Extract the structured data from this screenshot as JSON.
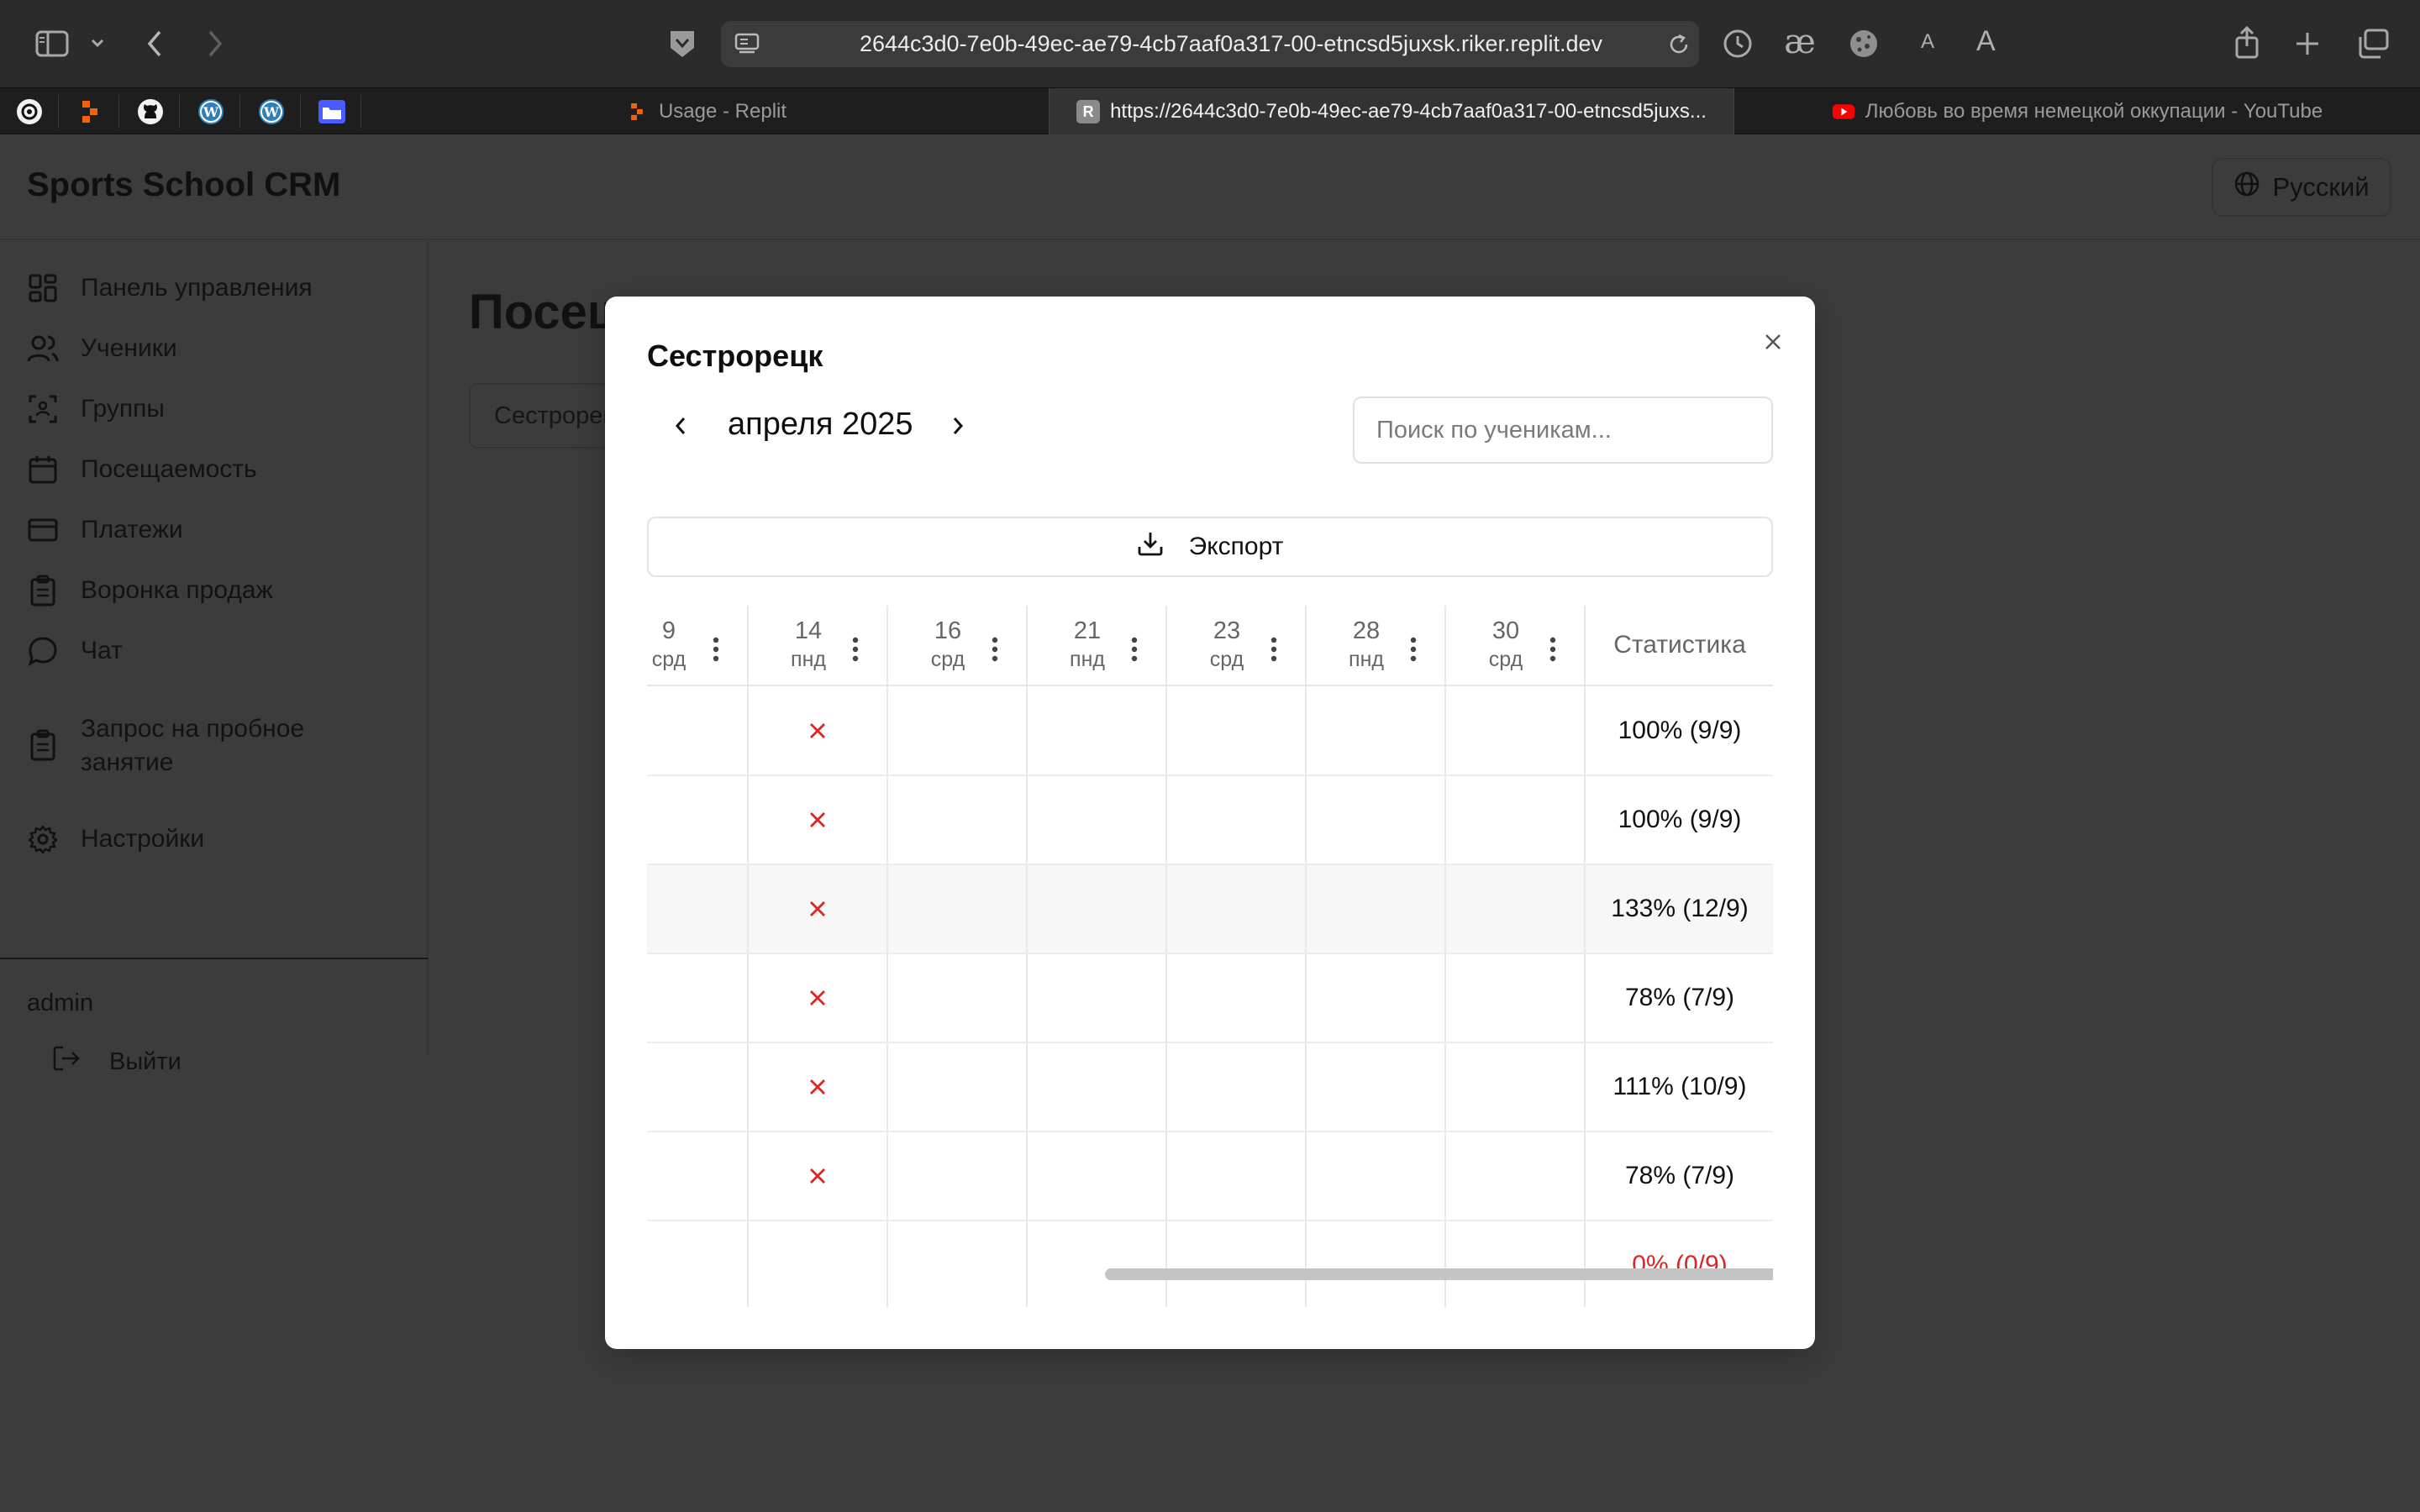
{
  "browser": {
    "url": "2644c3d0-7e0b-49ec-ae79-4cb7aaf0a317-00-etncsd5juxsk.riker.replit.dev",
    "font_small_label": "A",
    "font_large_label": "A",
    "tabs": [
      {
        "title": "Usage - Replit",
        "favicon": "replit-icon",
        "active": false
      },
      {
        "title": "https://2644c3d0-7e0b-49ec-ae79-4cb7aaf0a317-00-etncsd5juxs...",
        "favicon": "R",
        "active": true
      },
      {
        "title": "Любовь во время немецкой оккупации - YouTube",
        "favicon": "youtube-icon",
        "active": false
      }
    ]
  },
  "app": {
    "brand": "Sports School CRM",
    "language": "Русский",
    "page_title": "Посещаемость",
    "group_select": "Сестрорецк",
    "sidebar": {
      "items": [
        {
          "label": "Панель управления",
          "icon": "dashboard-icon"
        },
        {
          "label": "Ученики",
          "icon": "users-icon"
        },
        {
          "label": "Группы",
          "icon": "group-scan-icon"
        },
        {
          "label": "Посещаемость",
          "icon": "calendar-icon"
        },
        {
          "label": "Платежи",
          "icon": "credit-card-icon"
        },
        {
          "label": "Воронка продаж",
          "icon": "clipboard-icon"
        },
        {
          "label": "Чат",
          "icon": "chat-icon"
        },
        {
          "label": "Запрос на пробное занятие",
          "icon": "clipboard-icon"
        },
        {
          "label": "Настройки",
          "icon": "gear-icon"
        }
      ],
      "user": "admin",
      "logout": "Выйти"
    }
  },
  "modal": {
    "title": "Сестрорецк",
    "month": "апреля 2025",
    "search_placeholder": "Поиск по ученикам...",
    "export_label": "Экспорт",
    "stats_header": "Статистика",
    "dates": [
      {
        "num": "9",
        "day": "срд"
      },
      {
        "num": "14",
        "day": "пнд"
      },
      {
        "num": "16",
        "day": "срд"
      },
      {
        "num": "21",
        "day": "пнд"
      },
      {
        "num": "23",
        "day": "срд"
      },
      {
        "num": "28",
        "day": "пнд"
      },
      {
        "num": "30",
        "day": "срд"
      }
    ],
    "rows": [
      {
        "absent_on": "14",
        "stat": "100% (9/9)",
        "highlight": false,
        "zero": false
      },
      {
        "absent_on": "14",
        "stat": "100% (9/9)",
        "highlight": false,
        "zero": false
      },
      {
        "absent_on": "14",
        "stat": "133% (12/9)",
        "highlight": true,
        "zero": false
      },
      {
        "absent_on": "14",
        "stat": "78% (7/9)",
        "highlight": false,
        "zero": false
      },
      {
        "absent_on": "14",
        "stat": "111% (10/9)",
        "highlight": false,
        "zero": false
      },
      {
        "absent_on": "14",
        "stat": "78% (7/9)",
        "highlight": false,
        "zero": false
      },
      {
        "absent_on": "",
        "stat": "0% (0/9)",
        "highlight": false,
        "zero": true
      }
    ],
    "colors": {
      "absent": "#dc2626",
      "zero_stat": "#dc2626"
    }
  }
}
